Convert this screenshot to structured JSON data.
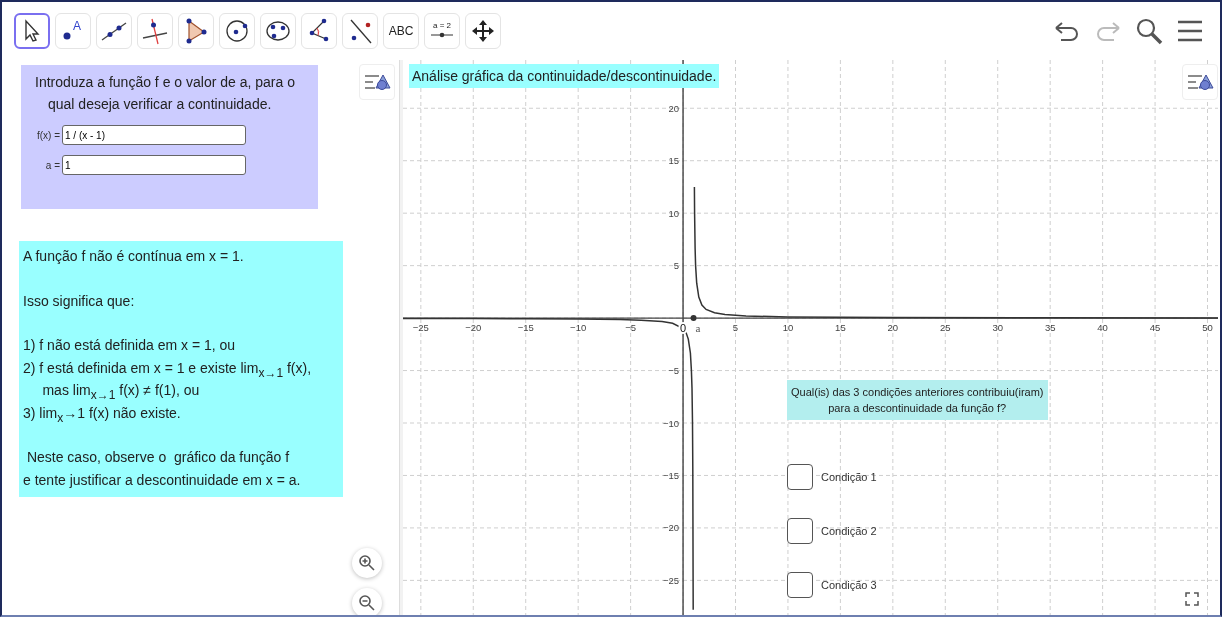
{
  "toolbar": {
    "tools": [
      {
        "kind": "move",
        "selected": true
      },
      {
        "kind": "point",
        "label": "A",
        "selected": false
      },
      {
        "kind": "line",
        "selected": false
      },
      {
        "kind": "perpendicular",
        "selected": false
      },
      {
        "kind": "polygon",
        "selected": false
      },
      {
        "kind": "circle",
        "selected": false
      },
      {
        "kind": "conic",
        "selected": false
      },
      {
        "kind": "angle",
        "selected": false
      },
      {
        "kind": "reflect",
        "selected": false
      },
      {
        "kind": "text",
        "label": "ABC",
        "selected": false
      },
      {
        "kind": "slider",
        "label": "a = 2",
        "selected": false
      },
      {
        "kind": "pan",
        "selected": false
      }
    ],
    "actions": [
      {
        "kind": "undo"
      },
      {
        "kind": "redo"
      },
      {
        "kind": "search"
      },
      {
        "kind": "menu"
      }
    ]
  },
  "input_panel": {
    "intro": "Introduza a função f e o valor de a, para o qual deseja verificar a continuidade.",
    "fields": [
      {
        "label": "f(x) =",
        "value": "1 / (x - 1)"
      },
      {
        "label": "a =",
        "value": "1"
      }
    ]
  },
  "result_panel": {
    "paragraphs": [
      {
        "lines": [
          "A função f não é contínua em x = 1."
        ]
      },
      {
        "lines": [
          "Isso significa que:"
        ]
      },
      {
        "lines": [
          "1) f não está definida em x = 1, ou",
          "2) f está definida em x = 1 e existe lim$_{x→1}$ f(x),",
          "     mas lim$_{x→1}$ f(x) ≠ f(1), ou",
          "3) lim$_{x}$→1 f(x) não existe."
        ]
      },
      {
        "lines": [
          " Neste caso, observe o  gráfico da função f",
          "e tente justificar a descontinuidade em x = a."
        ]
      }
    ]
  },
  "graphics": {
    "title": "Análise gráfica da continuidade/descontinuidade.",
    "chart_data": {
      "type": "line",
      "grid": true,
      "xlim": [
        -26.7,
        51
      ],
      "ylim": [
        -28.3,
        24.6
      ],
      "xticks": [
        {
          "value": -25,
          "label": "−25"
        },
        {
          "value": -20,
          "label": "−20"
        },
        {
          "value": -15,
          "label": "−15"
        },
        {
          "value": -10,
          "label": "−10"
        },
        {
          "value": -5,
          "label": "−5"
        },
        0,
        5,
        10,
        15,
        20,
        25,
        30,
        35,
        40,
        45,
        50
      ],
      "yticks": [
        {
          "value": -25,
          "label": "−25"
        },
        {
          "value": -20,
          "label": "−20"
        },
        {
          "value": -15,
          "label": "−15"
        },
        {
          "value": -10,
          "label": "−10"
        },
        {
          "value": -5,
          "label": "−5"
        },
        5,
        10,
        15,
        20
      ],
      "x": [
        -26.7,
        -20,
        -15,
        -10,
        -6,
        -4,
        -2,
        -1,
        0,
        0.3,
        0.5,
        0.7,
        0.8,
        0.85,
        0.9,
        0.93,
        0.96,
        0.964,
        1,
        1.08,
        1.1,
        1.15,
        1.2,
        1.3,
        1.5,
        1.8,
        2.2,
        3,
        4,
        6,
        10,
        20,
        35,
        51
      ],
      "series": [
        {
          "color": "#333333",
          "values": [
            -0.04,
            -0.05,
            -0.06,
            -0.09,
            -0.14,
            -0.2,
            -0.33,
            -0.5,
            -1,
            -1.43,
            -2,
            -3.33,
            -5,
            -6.67,
            -10,
            -14.3,
            -25,
            -27.8,
            null,
            12.5,
            10,
            6.67,
            5,
            3.33,
            2,
            1.25,
            0.83,
            0.5,
            0.33,
            0.2,
            0.11,
            0.05,
            0.03,
            0.02
          ]
        }
      ]
    },
    "point": {
      "label": "a"
    },
    "question": "Qual(is) das 3 condições anteriores contribuiu(iram)\npara a descontinuidade da função f?",
    "conditions": [
      {
        "label": "Condição 1",
        "checked": false
      },
      {
        "label": "Condição 2",
        "checked": false
      },
      {
        "label": "Condição 3",
        "checked": false
      }
    ]
  }
}
